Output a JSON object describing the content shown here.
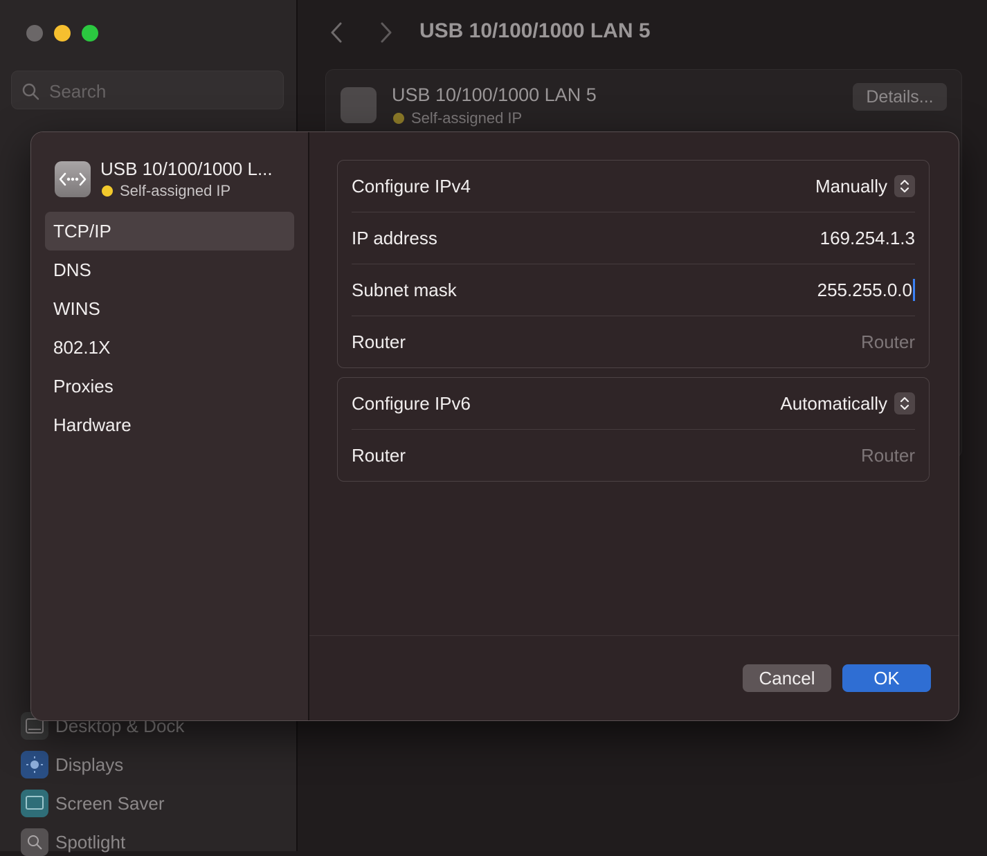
{
  "window": {
    "title": "USB 10/100/1000 LAN 5"
  },
  "search": {
    "placeholder": "Search"
  },
  "background_sidebar": {
    "items": [
      {
        "label": "Desktop & Dock",
        "icon": "dock-icon",
        "color": "#3a3a3a"
      },
      {
        "label": "Displays",
        "icon": "sun-icon",
        "color": "#2a5ea8"
      },
      {
        "label": "Screen Saver",
        "icon": "screensaver-icon",
        "color": "#3f8f9a"
      },
      {
        "label": "Spotlight",
        "icon": "magnifier-icon",
        "color": "#6a6a6a"
      }
    ]
  },
  "background_card": {
    "title": "USB 10/100/1000 LAN 5",
    "status": "Self-assigned IP",
    "details_label": "Details..."
  },
  "sheet": {
    "interface_name": "USB 10/100/1000 L...",
    "interface_status": "Self-assigned IP",
    "nav": [
      {
        "label": "TCP/IP",
        "selected": true
      },
      {
        "label": "DNS",
        "selected": false
      },
      {
        "label": "WINS",
        "selected": false
      },
      {
        "label": "802.1X",
        "selected": false
      },
      {
        "label": "Proxies",
        "selected": false
      },
      {
        "label": "Hardware",
        "selected": false
      }
    ],
    "ipv4": {
      "configure_label": "Configure IPv4",
      "configure_value": "Manually",
      "ip_label": "IP address",
      "ip_value": "169.254.1.3",
      "subnet_label": "Subnet mask",
      "subnet_value": "255.255.0.0",
      "router_label": "Router",
      "router_placeholder": "Router"
    },
    "ipv6": {
      "configure_label": "Configure IPv6",
      "configure_value": "Automatically",
      "router_label": "Router",
      "router_value": "Router"
    },
    "buttons": {
      "cancel": "Cancel",
      "ok": "OK"
    }
  },
  "colors": {
    "accent": "#2f6ed3",
    "status_yellow": "#f2c92c",
    "close": "#6b6768",
    "minimize": "#f6bf2f",
    "maximize": "#2bc840"
  }
}
